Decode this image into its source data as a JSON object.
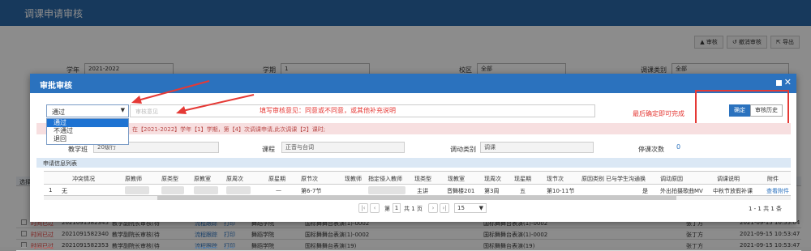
{
  "page": {
    "title": "调课申请审核"
  },
  "toolbar": {
    "audit": "审核",
    "cancel_audit": "撤消审核",
    "export": "导出"
  },
  "filters": {
    "year_label": "学年",
    "year_value": "2021-2022",
    "term_label": "学期",
    "term_value": "1",
    "campus_label": "校区",
    "campus_value": "全部",
    "type_label": "调课类别",
    "type_value": "全部"
  },
  "bg_table": {
    "select_label": "选择",
    "rows": [
      {
        "status": "时间已过",
        "id": "2021091582345",
        "dept": "教学副院长审核(待",
        "action": "流程跟踪",
        "print": "打印",
        "school": "舞蹈学院",
        "course": "国标舞舞台表演(1)-0002",
        "course2": "国标舞舞台表演(1)-0002",
        "teacher": "张丁方",
        "time": "2021-09-15 10:55:04"
      },
      {
        "status": "时间已过",
        "id": "2021091582340",
        "dept": "教学副院长审核(待",
        "action": "流程跟踪",
        "print": "打印",
        "school": "舞蹈学院",
        "course": "国标舞舞台表演(1)-0002",
        "course2": "国标舞舞台表演(1)-0002",
        "teacher": "张丁方",
        "time": "2021-09-15 10:53:47"
      },
      {
        "status": "时间已过",
        "id": "2021091582353",
        "dept": "教学副院长审核(待",
        "action": "流程跟踪",
        "print": "打印",
        "school": "舞蹈学院",
        "course": "国标舞舞台表演(19)",
        "course2": "国标舞舞台表演(19)",
        "teacher": "张丁方",
        "time": "2021-09-15 10:53:47"
      }
    ]
  },
  "modal": {
    "title": "审批审核",
    "audit_value": "通过",
    "audit_options": [
      "通过",
      "不通过",
      "退回"
    ],
    "opinion_placeholder": "审核意见",
    "annotation_opinion": "填写审核意见：同意或不同意，或其他补充说明",
    "annotation_confirm": "最后确定即可完成",
    "confirm_label": "确定",
    "history_label": "审核历史",
    "notice": "在【2021-2022】学年【1】学期，第【4】次调课申请,此次调课【2】课时;",
    "info": {
      "class_label": "教学班",
      "class_value": "20级行",
      "course_label": "课程",
      "course_value": "正音与台词",
      "type_label": "调动类别",
      "type_value": "调课",
      "count_label": "停课次数",
      "count_value": "0"
    },
    "list_title": "申请信息列表",
    "columns": [
      "冲突情况",
      "原教师",
      "原类型",
      "原教室",
      "原周次",
      "原星期",
      "原节次",
      "现教师",
      "指定侵入教师",
      "现类型",
      "现教室",
      "现周次",
      "现星期",
      "现节次",
      "原因类别",
      "已与学生沟通换",
      "调动原因",
      "调课说明",
      "附件"
    ],
    "row": {
      "index": "1",
      "conflict": "无",
      "orig_weekday": "—",
      "orig_period": "第6-7节",
      "cur_type": "主讲",
      "cur_room": "音舞楼201",
      "cur_week": "第3周",
      "cur_weekday": "五",
      "cur_period": "第10-11节",
      "communicated": "是",
      "reason": "外出拍摄歌曲MV",
      "note": "中秋节放假补课",
      "attachment": "查看附件"
    },
    "pager": {
      "page_prefix": "第",
      "current_page": "1",
      "total_pages": "共 1 页",
      "page_size": "15",
      "info": "1 - 1  共 1 条"
    }
  }
}
